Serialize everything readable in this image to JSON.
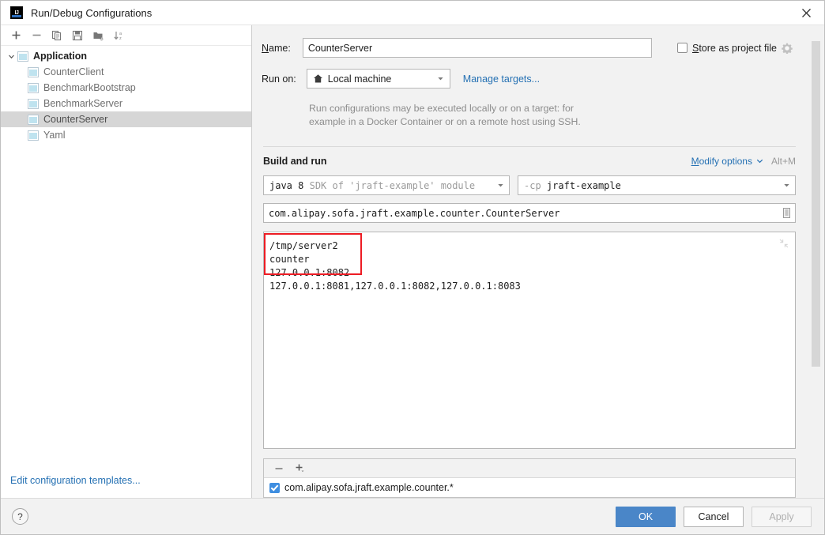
{
  "window": {
    "title": "Run/Debug Configurations",
    "logo_text": "IJ",
    "close_icon": "close-icon"
  },
  "sidebar": {
    "toolbar": [
      {
        "icon": "add-icon",
        "label": "+"
      },
      {
        "icon": "remove-icon",
        "label": "−"
      },
      {
        "icon": "copy-icon",
        "label": "Copy"
      },
      {
        "icon": "save-icon",
        "label": "Save"
      },
      {
        "icon": "new-folder-icon",
        "label": "New Folder"
      },
      {
        "icon": "sort-alphabetically-icon",
        "label": "Sort"
      }
    ],
    "tree": {
      "group_label": "Application",
      "items": [
        {
          "label": "CounterClient",
          "selected": false
        },
        {
          "label": "BenchmarkBootstrap",
          "selected": false
        },
        {
          "label": "BenchmarkServer",
          "selected": false
        },
        {
          "label": "CounterServer",
          "selected": true
        },
        {
          "label": "Yaml",
          "selected": false
        }
      ]
    },
    "edit_templates_link": "Edit configuration templates..."
  },
  "form": {
    "name_label": "Name:",
    "name_value": "CounterServer",
    "store_as_project_file_label": "Store as project file",
    "store_as_project_file_checked": false,
    "store_gear_icon": "gear-icon",
    "run_on_label": "Run on:",
    "run_on_value": "Local machine",
    "run_on_icon": "home-icon",
    "manage_targets_link": "Manage targets...",
    "description_line1": "Run configurations may be executed locally or on a target: for",
    "description_line2": "example in a Docker Container or on a remote host using SSH."
  },
  "build_and_run": {
    "section_title": "Build and run",
    "modify_options_link": "Modify options",
    "modify_options_shortcut": "Alt+M",
    "sdk_combo": {
      "value_bold": "java 8",
      "value_gray": "SDK of 'jraft-example' module"
    },
    "classpath_combo": {
      "prefix": "-cp",
      "value": "jraft-example"
    },
    "main_class": "com.alipay.sofa.jraft.example.counter.CounterServer",
    "main_class_icon": "class-chooser-icon",
    "program_arguments": [
      "/tmp/server2",
      "counter",
      "127.0.0.1:8082",
      "127.0.0.1:8081,127.0.0.1:8082,127.0.0.1:8083"
    ],
    "expand_icon": "collapse-arrows-icon",
    "annotation": {
      "type": "red-rectangle-highlight",
      "color": "#ed1c24",
      "covers_lines": 3
    }
  },
  "before_launch": {
    "toolbar": [
      {
        "icon": "remove-icon",
        "label": "−"
      },
      {
        "icon": "add-dropdown-icon",
        "label": "+"
      }
    ],
    "rows": [
      {
        "label": "com.alipay.sofa.jraft.example.counter.*",
        "checked": true
      }
    ]
  },
  "footer": {
    "help_label": "?",
    "ok_label": "OK",
    "cancel_label": "Cancel",
    "apply_label": "Apply",
    "apply_disabled": true
  },
  "colors": {
    "accent_blue": "#4a86c8",
    "link_blue": "#2470b3",
    "annotation_red": "#ed1c24",
    "selection_gray": "#d6d6d6"
  }
}
